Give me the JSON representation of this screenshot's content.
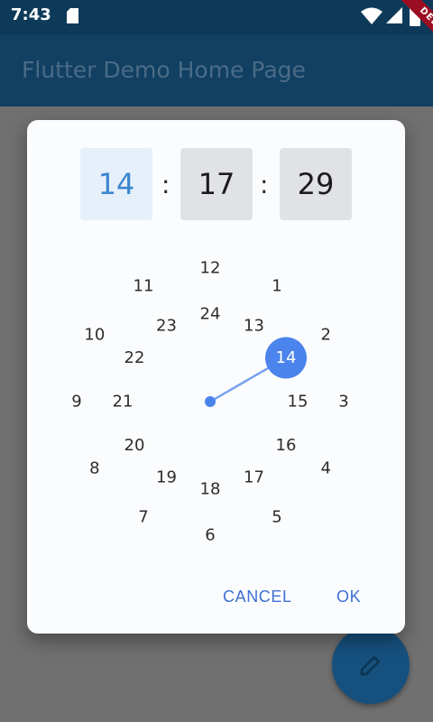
{
  "status_bar": {
    "time": "7:43",
    "icons": [
      "sd-card-icon",
      "wifi-icon",
      "signal-icon",
      "battery-icon"
    ]
  },
  "debug_banner": {
    "label": "DEBUG"
  },
  "app_bar": {
    "title": "Flutter Demo Home Page"
  },
  "time_picker": {
    "hour": "14",
    "separator_1": ":",
    "minute": "17",
    "separator_2": ":",
    "second": "29",
    "active_segment": "hour",
    "selected_value": "14",
    "outer_ring": [
      "12",
      "1",
      "2",
      "3",
      "4",
      "5",
      "6",
      "7",
      "8",
      "9",
      "10",
      "11"
    ],
    "inner_ring": [
      "24",
      "13",
      "14",
      "15",
      "16",
      "17",
      "18",
      "19",
      "20",
      "21",
      "22",
      "23"
    ]
  },
  "actions": {
    "cancel_label": "CANCEL",
    "ok_label": "OK"
  },
  "fab": {
    "icon": "edit-icon"
  },
  "colors": {
    "accent": "#3a86cf",
    "selection_fill": "#4a84ec",
    "hand": "#7aa3ee",
    "app_bar": "#114063",
    "scrim": "#707070",
    "dialog": "#fbfcfe"
  }
}
